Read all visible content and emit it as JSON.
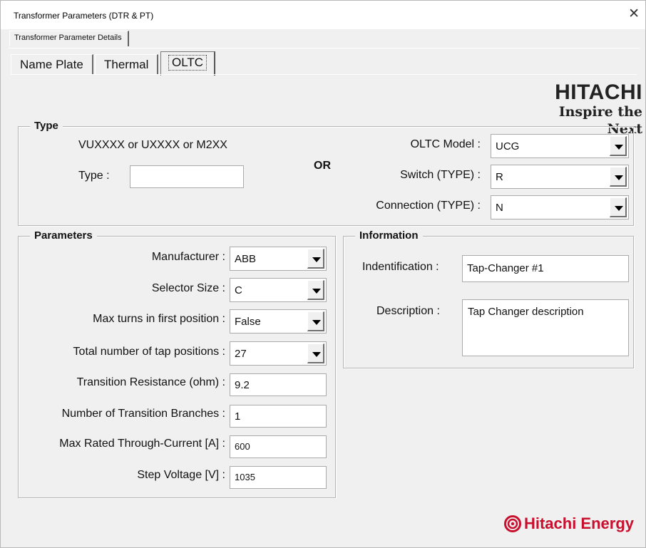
{
  "window": {
    "title": "Transformer Parameters (DTR & PT)"
  },
  "outer_tab": {
    "label": "Transformer Parameter Details"
  },
  "tabs": [
    {
      "label": "Name Plate",
      "active": false
    },
    {
      "label": "Thermal",
      "active": false
    },
    {
      "label": "OLTC",
      "active": true
    }
  ],
  "logo": {
    "brand": "HITACHI",
    "tagline": "Inspire the Next"
  },
  "type_group": {
    "title": "Type",
    "hint": "VUXXXX or UXXXX or M2XX",
    "type_label": "Type :",
    "type_value": "",
    "or_label": "OR",
    "oltc_model_label": "OLTC Model :",
    "oltc_model_value": "UCG",
    "switch_label": "Switch (TYPE) :",
    "switch_value": "R",
    "connection_label": "Connection (TYPE) :",
    "connection_value": "N"
  },
  "parameters": {
    "title": "Parameters",
    "manufacturer_label": "Manufacturer :",
    "manufacturer_value": "ABB",
    "selector_size_label": "Selector Size :",
    "selector_size_value": "C",
    "max_turns_label": "Max turns in first position :",
    "max_turns_value": "False",
    "total_taps_label": "Total number of tap positions :",
    "total_taps_value": "27",
    "transition_res_label": "Transition Resistance (ohm) :",
    "transition_res_value": "9.2",
    "transition_branches_label": "Number of Transition Branches :",
    "transition_branches_value": "1",
    "max_current_label": "Max Rated Through-Current [A] :",
    "max_current_value": "600",
    "step_voltage_label": "Step Voltage [V] :",
    "step_voltage_value": "1035"
  },
  "information": {
    "title": "Information",
    "identification_label": "Indentification :",
    "identification_value": "Tap-Changer #1",
    "description_label": "Description :",
    "description_value": "Tap Changer description"
  },
  "footer_logo": {
    "text": "Hitachi Energy",
    "color": "#c8102e"
  }
}
